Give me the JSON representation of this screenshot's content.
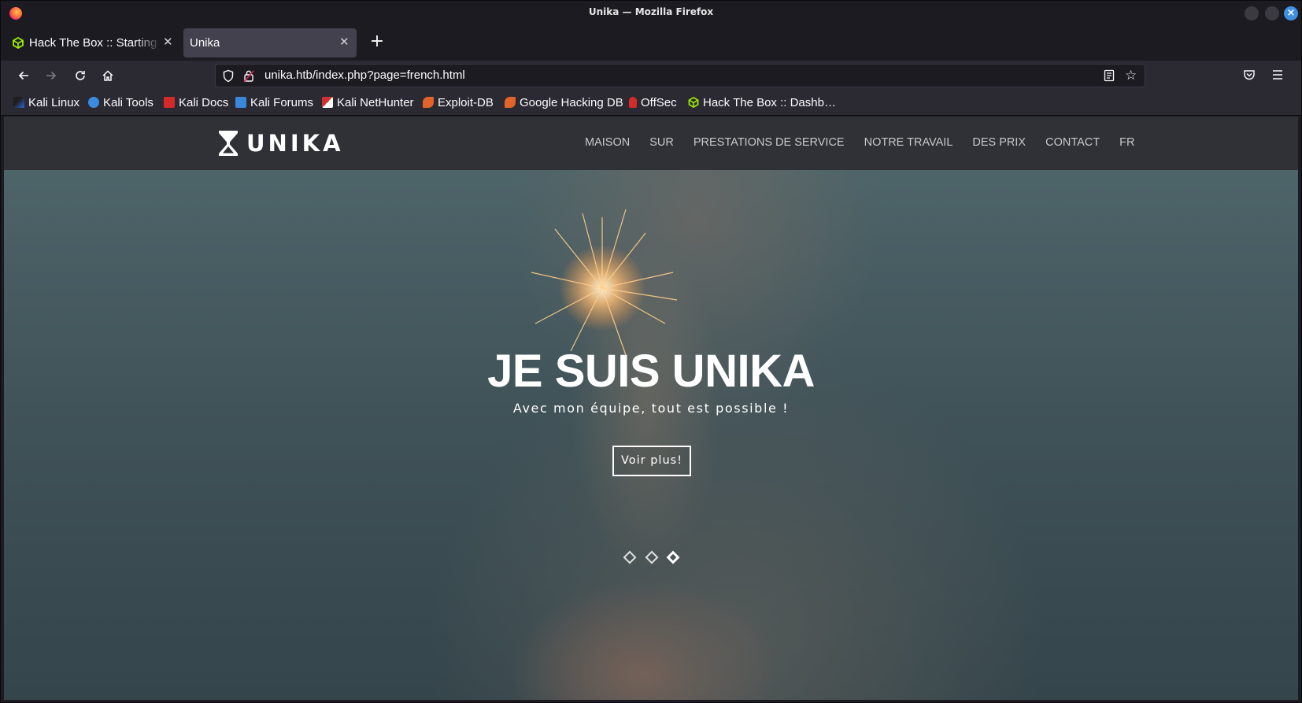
{
  "window": {
    "title": "Unika — Mozilla Firefox"
  },
  "tabs": [
    {
      "label": "Hack The Box :: Starting Point",
      "icon": "htb-cube-icon",
      "active": false
    },
    {
      "label": "Unika",
      "active": true
    }
  ],
  "nav": {
    "url": "unika.htb/index.php?page=french.html"
  },
  "bookmarks": [
    {
      "label": "Kali Linux",
      "icon": "kali-dragon-icon",
      "color": "#2b6bd8"
    },
    {
      "label": "Kali Tools",
      "icon": "kali-tools-icon",
      "color": "#3c8be0"
    },
    {
      "label": "Kali Docs",
      "icon": "kali-docs-icon",
      "color": "#d42a2a"
    },
    {
      "label": "Kali Forums",
      "icon": "kali-forums-icon",
      "color": "#3a86d8"
    },
    {
      "label": "Kali NetHunter",
      "icon": "nethunter-icon",
      "color": "#cf3232"
    },
    {
      "label": "Exploit-DB",
      "icon": "exploitdb-icon",
      "color": "#e3642b"
    },
    {
      "label": "Google Hacking DB",
      "icon": "ghdb-icon",
      "color": "#e3642b"
    },
    {
      "label": "OffSec",
      "icon": "offsec-icon",
      "color": "#d42a2a"
    },
    {
      "label": "Hack The Box :: Dashb…",
      "icon": "htb-cube-icon",
      "color": "#9fef00"
    }
  ],
  "site": {
    "logo_text": "UNIKA",
    "nav_items": [
      "MAISON",
      "SUR",
      "PRESTATIONS DE SERVICE",
      "NOTRE TRAVAIL",
      "DES PRIX",
      "CONTACT",
      "FR"
    ],
    "hero": {
      "title": "JE SUIS UNIKA",
      "subtitle": "Avec mon équipe, tout est possible !",
      "button": "Voir plus!",
      "slides": 3,
      "active_slide": 3
    }
  }
}
